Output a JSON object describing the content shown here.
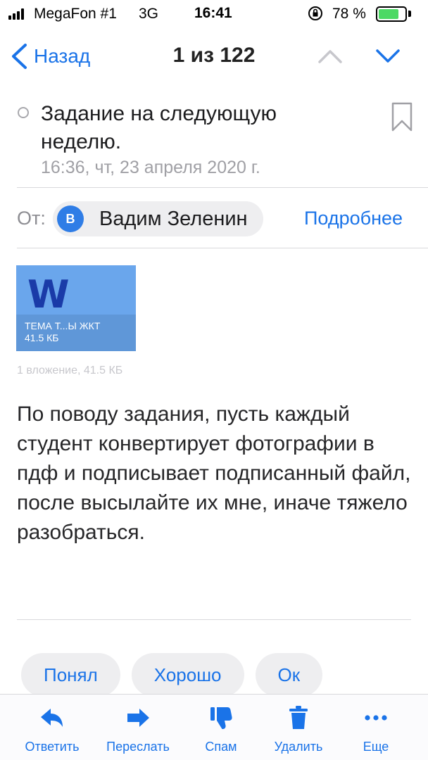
{
  "status_bar": {
    "carrier": "MegaFon #1",
    "network": "3G",
    "time": "16:41",
    "battery_percent": "78 %",
    "battery_level": 0.78
  },
  "nav": {
    "back_label": "Назад",
    "title": "1 из 122"
  },
  "message": {
    "subject": "Задание на следующую неделю.",
    "date": "16:36, чт, 23 апреля 2020 г.",
    "from_label": "От:",
    "sender_initial": "В",
    "sender_name": "Вадим Зеленин",
    "details_link": "Подробнее",
    "attachment": {
      "name": "ТЕМА Т...Ы ЖКТ",
      "size": "41.5 КБ",
      "type_letter": "W"
    },
    "attachment_summary": "1 вложение, 41.5 КБ",
    "body": "По поводу задания, пусть каждый студент конвертирует фотографии в пдф и подписывает подписанный файл, после высылайте их мне, иначе тяжело разобраться."
  },
  "quick_replies": [
    "Понял",
    "Хорошо",
    "Ок"
  ],
  "toolbar": {
    "reply": "Ответить",
    "forward": "Переслать",
    "spam": "Спам",
    "delete": "Удалить",
    "more": "Еще"
  },
  "colors": {
    "accent": "#1a73e8",
    "battery": "#4cd964",
    "attachment_bg": "#6aa6ec"
  }
}
